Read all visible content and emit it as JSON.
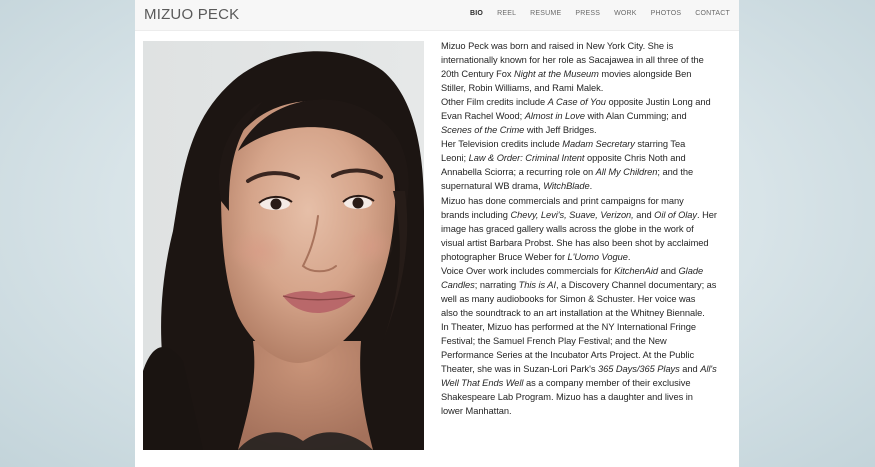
{
  "site": {
    "title": "MIZUO PECK"
  },
  "nav": {
    "items": [
      "BIO",
      "REEL",
      "RESUME",
      "PRESS",
      "WORK",
      "PHOTOS",
      "CONTACT"
    ],
    "active": "BIO"
  },
  "photo": {
    "alt": "Portrait of Mizuo Peck"
  },
  "bio": {
    "lines": [
      [
        {
          "t": "Mizuo Peck was born and raised in New York City. She is"
        }
      ],
      [
        {
          "t": "internationally known for her role as Sacajawea in all three of the"
        }
      ],
      [
        {
          "t": "20th Century Fox "
        },
        {
          "t": "Night at the Museum",
          "i": true
        },
        {
          "t": " movies alongside Ben"
        }
      ],
      [
        {
          "t": "Stiller, Robin Williams, and Rami Malek."
        }
      ],
      [
        {
          "t": "Other Film credits include "
        },
        {
          "t": "A Case of You",
          "i": true
        },
        {
          "t": " opposite Justin Long and"
        }
      ],
      [
        {
          "t": "Evan Rachel Wood; "
        },
        {
          "t": "Almost in Love",
          "i": true
        },
        {
          "t": " with Alan Cumming; and"
        }
      ],
      [
        {
          "t": "Scenes of the Crime",
          "i": true
        },
        {
          "t": " with Jeff Bridges."
        }
      ],
      [
        {
          "t": "Her Television credits include "
        },
        {
          "t": "Madam Secretary",
          "i": true
        },
        {
          "t": " starring Tea"
        }
      ],
      [
        {
          "t": "Leoni; "
        },
        {
          "t": "Law & Order: Criminal Intent",
          "i": true
        },
        {
          "t": " opposite Chris Noth and"
        }
      ],
      [
        {
          "t": "Annabella Sciorra; a recurring role on "
        },
        {
          "t": "All My Children",
          "i": true
        },
        {
          "t": "; and the"
        }
      ],
      [
        {
          "t": "supernatural WB drama, "
        },
        {
          "t": "WitchBlade",
          "i": true
        },
        {
          "t": "."
        }
      ],
      [
        {
          "t": "Mizuo has done commercials and print campaigns for many"
        }
      ],
      [
        {
          "t": "brands including "
        },
        {
          "t": "Chevy, Levi's, Suave, Verizon,",
          "i": true
        },
        {
          "t": " and "
        },
        {
          "t": "Oil of Olay",
          "i": true
        },
        {
          "t": ". Her"
        }
      ],
      [
        {
          "t": "image has graced gallery walls across the globe in the work of"
        }
      ],
      [
        {
          "t": "visual artist Barbara Probst. She has also been shot by acclaimed"
        }
      ],
      [
        {
          "t": "photographer Bruce Weber for "
        },
        {
          "t": "L'Uomo Vogue",
          "i": true
        },
        {
          "t": "."
        }
      ],
      [
        {
          "t": "Voice Over work includes commercials for "
        },
        {
          "t": "KitchenAid",
          "i": true
        },
        {
          "t": " and "
        },
        {
          "t": "Glade",
          "i": true
        }
      ],
      [
        {
          "t": "Candles",
          "i": true
        },
        {
          "t": "; narrating "
        },
        {
          "t": "This is AI",
          "i": true
        },
        {
          "t": ", a Discovery Channel documentary; as"
        }
      ],
      [
        {
          "t": "well as many audiobooks for Simon & Schuster. Her voice was"
        }
      ],
      [
        {
          "t": "also the soundtrack to an art installation at the Whitney Biennale."
        }
      ],
      [
        {
          "t": "In Theater, Mizuo has performed at the NY International Fringe"
        }
      ],
      [
        {
          "t": "Festival; the Samuel French Play Festival; and the New"
        }
      ],
      [
        {
          "t": "Performance Series at the Incubator Arts Project. At the Public"
        }
      ],
      [
        {
          "t": "Theater, she was in Suzan-Lori Park's "
        },
        {
          "t": "365 Days/365 Plays",
          "i": true
        },
        {
          "t": " and "
        },
        {
          "t": "All's",
          "i": true
        }
      ],
      [
        {
          "t": "Well That Ends Well",
          "i": true
        },
        {
          "t": " as a company member of their exclusive"
        }
      ],
      [
        {
          "t": "Shakespeare Lab Program. Mizuo has a daughter and lives in"
        }
      ],
      [
        {
          "t": "lower Manhattan."
        }
      ]
    ]
  }
}
